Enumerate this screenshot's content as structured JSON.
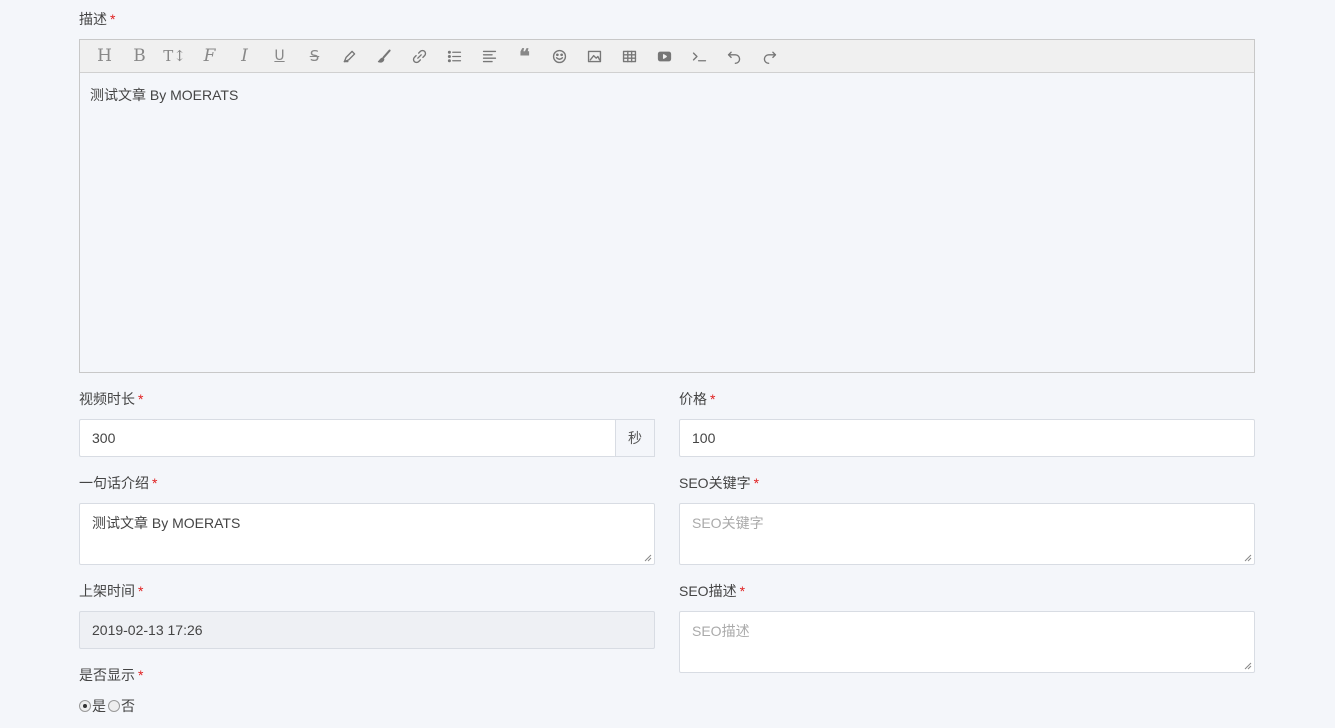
{
  "description": {
    "label": "描述",
    "required_mark": "*",
    "toolbar": [
      {
        "name": "heading-icon",
        "glyph": "H"
      },
      {
        "name": "bold-icon",
        "glyph": "B"
      },
      {
        "name": "text-size-icon",
        "glyph": "T↕"
      },
      {
        "name": "font-icon",
        "glyph": "F"
      },
      {
        "name": "italic-icon",
        "glyph": "I"
      },
      {
        "name": "underline-icon",
        "glyph": "U"
      },
      {
        "name": "strikethrough-icon",
        "glyph": "S"
      },
      {
        "name": "highlighter-icon",
        "glyph": ""
      },
      {
        "name": "paintbrush-icon",
        "glyph": ""
      },
      {
        "name": "link-icon",
        "glyph": ""
      },
      {
        "name": "list-icon",
        "glyph": ""
      },
      {
        "name": "align-icon",
        "glyph": ""
      },
      {
        "name": "quote-icon",
        "glyph": "❝"
      },
      {
        "name": "emoji-icon",
        "glyph": ""
      },
      {
        "name": "image-icon",
        "glyph": ""
      },
      {
        "name": "table-icon",
        "glyph": ""
      },
      {
        "name": "video-icon",
        "glyph": ""
      },
      {
        "name": "code-icon",
        "glyph": ""
      },
      {
        "name": "undo-icon",
        "glyph": ""
      },
      {
        "name": "redo-icon",
        "glyph": ""
      }
    ],
    "content": "测试文章 By MOERATS"
  },
  "duration": {
    "label": "视频时长",
    "value": "300",
    "unit": "秒"
  },
  "price": {
    "label": "价格",
    "value": "100"
  },
  "intro": {
    "label": "一句话介绍",
    "value": "测试文章 By MOERATS"
  },
  "seo_keywords": {
    "label": "SEO关键字",
    "placeholder": "SEO关键字"
  },
  "publish_time": {
    "label": "上架时间",
    "value": "2019-02-13 17:26"
  },
  "seo_description": {
    "label": "SEO描述",
    "placeholder": "SEO描述"
  },
  "visible": {
    "label": "是否显示",
    "options": [
      {
        "label": "是",
        "checked": true
      },
      {
        "label": "否",
        "checked": false
      }
    ]
  },
  "colors": {
    "required": "#e02020",
    "border": "#d8dce3",
    "background": "#f4f6fa"
  }
}
